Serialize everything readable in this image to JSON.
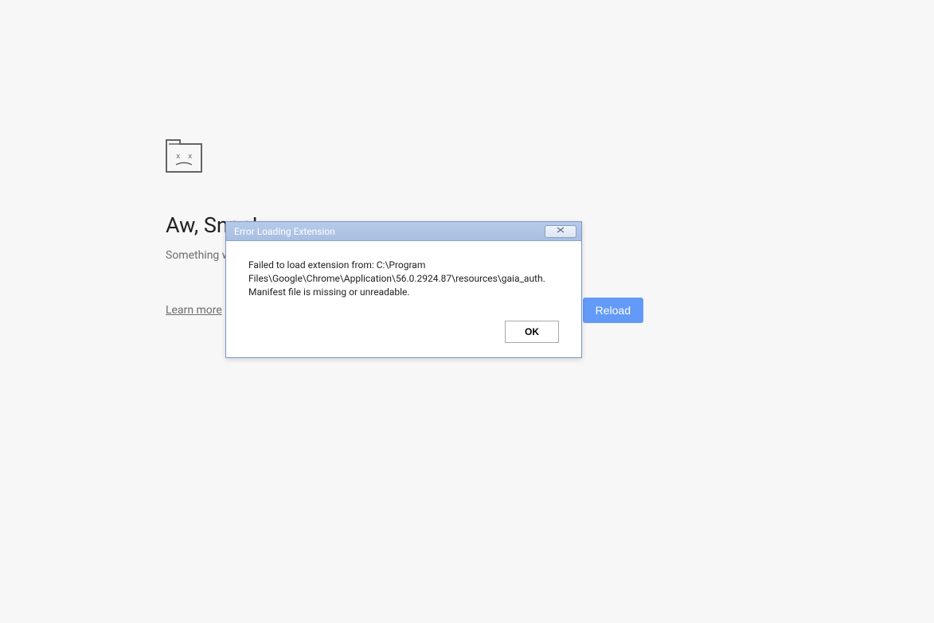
{
  "error_page": {
    "title": "Aw, Snap!",
    "subtitle": "Something we",
    "learn_more": "Learn more",
    "reload_label": "Reload"
  },
  "dialog": {
    "title": "Error Loading Extension",
    "message": "Failed to load extension from: C:\\Program Files\\Google\\Chrome\\Application\\56.0.2924.87\\resources\\gaia_auth. Manifest file is missing or unreadable.",
    "ok_label": "OK"
  }
}
